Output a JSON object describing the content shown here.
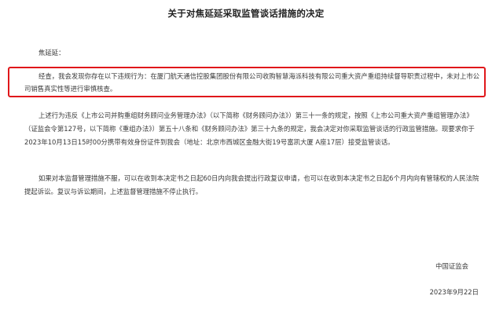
{
  "document": {
    "title": "关于对焦延延采取监管谈话措施的决定",
    "salutation": "焦延延：",
    "paragraphs": {
      "p1": {
        "line1": "经查，我会发现你存在以下违规行为：在厦门航天通信控股集团股份有限公司收购智慧海派科技有限公司重大资产重组持续督导职责过程中，未对上市公",
        "line2": "司销售真实性等进行审慎核查。"
      },
      "p2": {
        "line1": "上述行为违反《上市公司并购重组财务顾问业务管理办法》（以下简称《财务顾问办法》）第三十一条的规定，按照《上市公司重大资产重组管理办法》",
        "line2": "（证监会令第127号，以下简称《重组办法》）第五十八条和《财务顾问办法》第三十九条的规定，我会决定对你采取监管谈话的行政监管措施。现要求你于",
        "line3": "2023年10月13日15时00分携带有效身份证件到我会（地址：北京市西城区金融大街19号富凯大厦 A座17层）接受监管谈话。"
      },
      "p3": {
        "line1": "如果对本监督管理措施不服，可以在收到本决定书之日起60日内向我会提出行政复议申请，也可以在收到本决定书之日起6个月内向有管辖权的人民法院",
        "line2": "提起诉讼。复议与诉讼期间，上述监督管理措施不停止执行。"
      }
    },
    "signature": "中国证监会",
    "date": "2023年9月22日"
  },
  "colors": {
    "highlight_border": "#e0171a",
    "text": "#3a3a3a",
    "title": "#222222"
  }
}
